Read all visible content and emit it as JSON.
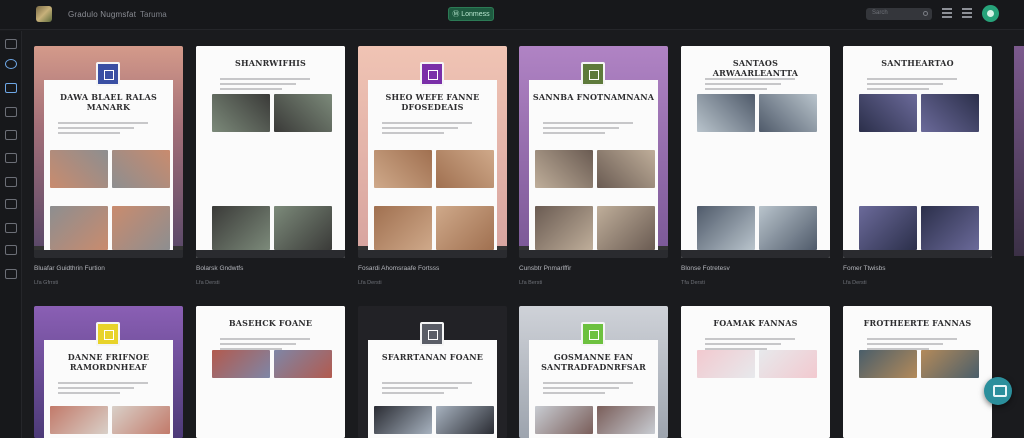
{
  "app": {
    "title": "Gradulo Nugmsfat",
    "menu": "Taruma",
    "create_label": "Ⓜ Lonmess",
    "search_placeholder": "Sarch"
  },
  "cards": [
    {
      "name": "Bluafar Guidthrin Furtion",
      "sub": "Lfa  Gfrrsti",
      "title": "DAWA BLAEL RALAS MANARK",
      "cover": "sunset",
      "badge": "#3a4fa3"
    },
    {
      "name": "Bolarsk Gndwtfs",
      "sub": "Lfa  Dersti",
      "title": "SHANRWIFHIS",
      "cover": "white",
      "badge": ""
    },
    {
      "name": "Fosardi Ahomsraafe Fortsss",
      "sub": "Lfa  Dersti",
      "title": "SHEO WEFE FANNE DFOSEDEAIS",
      "cover": "peach",
      "badge": "#7a2fa8"
    },
    {
      "name": "Cunsbtr Pnmarlffir",
      "sub": "Lfa  Bersti",
      "title": "SANNBA FNOTNAMNANA",
      "cover": "purple",
      "badge": "#5e7a3b"
    },
    {
      "name": "Blonse Fotretesv",
      "sub": "Tfa  Dersti",
      "title": "SANTAOS ARWAARLEANTTA",
      "cover": "white",
      "badge": ""
    },
    {
      "name": "Fomer Ttwisbs",
      "sub": "Lfa  Dersti",
      "title": "SANTHEARTAO",
      "cover": "white",
      "badge": ""
    },
    {
      "name": "",
      "sub": "",
      "title": "DANNE FRIFNOE RAMORDNHEAF",
      "cover": "violet",
      "badge": "#e8d32a"
    },
    {
      "name": "",
      "sub": "",
      "title": "BASEHCK FOANE",
      "cover": "white",
      "badge": ""
    },
    {
      "name": "",
      "sub": "",
      "title": "SFARRTANAN FOANE",
      "cover": "dark",
      "badge": "#5a5d66"
    },
    {
      "name": "",
      "sub": "",
      "title": "GOSMANNE FAN SANTRADFADNRFSAR",
      "cover": "grey",
      "badge": "#6dc13f"
    },
    {
      "name": "",
      "sub": "",
      "title": "FOAMAK FANNAS",
      "cover": "white",
      "badge": ""
    },
    {
      "name": "",
      "sub": "",
      "title": "FROTHEERTE FANNAS",
      "cover": "white",
      "badge": ""
    }
  ],
  "icons": {
    "logo": "app-logo-icon",
    "grid": "grid-view-icon",
    "list": "list-view-icon",
    "user": "user-avatar-icon",
    "chat": "chat-icon"
  }
}
